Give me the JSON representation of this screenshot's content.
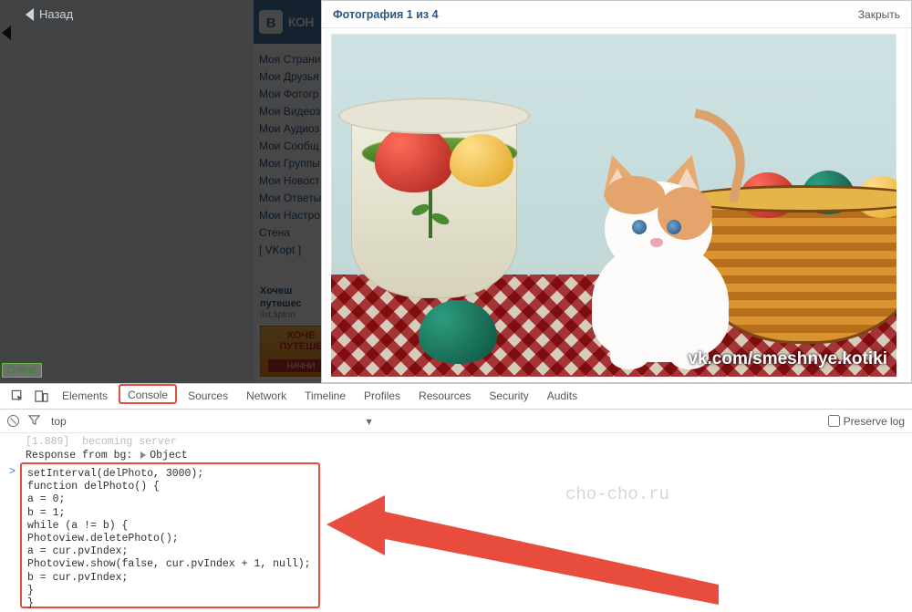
{
  "back_label": "Назад",
  "online_label": "Online",
  "vk_logo_text": "КОН",
  "vk_logo_letter": "в",
  "nav_items": [
    "Моя Страни",
    "Мои Друзья",
    "Мои Фотогр",
    "Мои Видеоз",
    "Мои Аудиоз",
    "Мои Сообщ",
    "Мои Группы",
    "Мои Новост",
    "Мои Ответы",
    "Мои Настро",
    "Стена",
    "[ VKopt ]"
  ],
  "ad": {
    "title": "Хочеш",
    "title2": "путешес",
    "sub": "list.lipton",
    "banner_top": "ХОЧЕ",
    "banner_mid": "ПУТЕШЕ",
    "banner_btn": "НАЧНИ"
  },
  "photo": {
    "title": "Фотография 1 из 4",
    "close": "Закрыть",
    "watermark": "vk.com/smeshnye.kotiki"
  },
  "devtools": {
    "tabs": [
      "Elements",
      "Console",
      "Sources",
      "Network",
      "Timeline",
      "Profiles",
      "Resources",
      "Security",
      "Audits"
    ],
    "active_tab_index": 1,
    "context": "top",
    "context_arrow": "▾",
    "preserve_label": "Preserve log",
    "faded_line": "[1.889]  becoming server",
    "response_line_a": "Response from bg: ",
    "response_line_b": "Object",
    "code_lines": [
      "setInterval(delPhoto, 3000);",
      "function delPhoto() {",
      "a = 0;",
      "b = 1;",
      "while (a != b) {",
      "Photoview.deletePhoto();",
      "a = cur.pvIndex;",
      "Photoview.show(false, cur.pvIndex + 1, null);",
      "b = cur.pvIndex;",
      "}",
      "}"
    ]
  },
  "page_watermark": "cho-cho.ru"
}
